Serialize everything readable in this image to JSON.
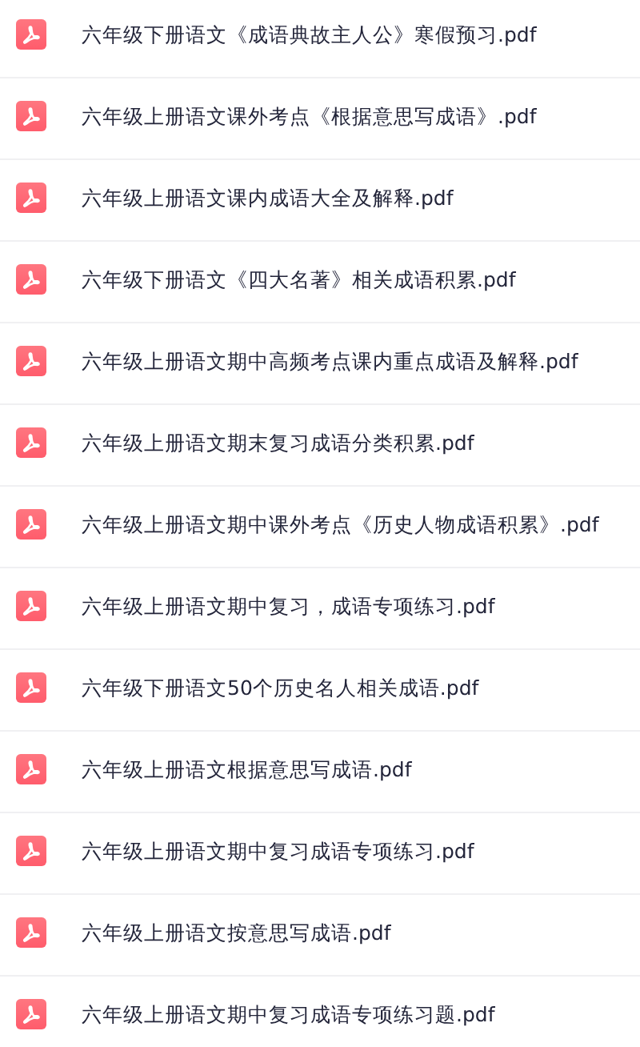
{
  "files": [
    {
      "name": "六年级下册语文《成语典故主人公》寒假预习.pdf"
    },
    {
      "name": "六年级上册语文课外考点《根据意思写成语》.pdf"
    },
    {
      "name": "六年级上册语文课内成语大全及解释.pdf"
    },
    {
      "name": "六年级下册语文《四大名著》相关成语积累.pdf"
    },
    {
      "name": "六年级上册语文期中高频考点课内重点成语及解释.pdf"
    },
    {
      "name": "六年级上册语文期末复习成语分类积累.pdf"
    },
    {
      "name": "六年级上册语文期中课外考点《历史人物成语积累》.pdf"
    },
    {
      "name": "六年级上册语文期中复习，成语专项练习.pdf"
    },
    {
      "name": "六年级下册语文50个历史名人相关成语.pdf"
    },
    {
      "name": "六年级上册语文根据意思写成语.pdf"
    },
    {
      "name": "六年级上册语文期中复习成语专项练习.pdf"
    },
    {
      "name": "六年级上册语文按意思写成语.pdf"
    },
    {
      "name": "六年级上册语文期中复习成语专项练习题.pdf"
    }
  ]
}
